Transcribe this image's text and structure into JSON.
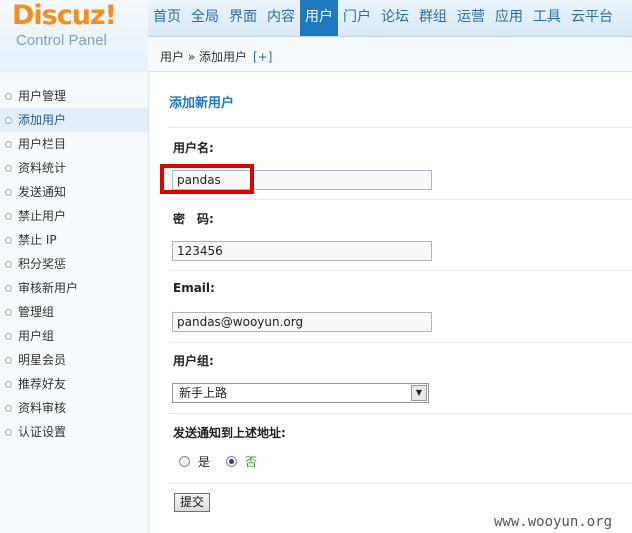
{
  "logo": {
    "main": "Discuz!",
    "sub": "Control Panel"
  },
  "topnav": [
    "首页",
    "全局",
    "界面",
    "内容",
    "用户",
    "门户",
    "论坛",
    "群组",
    "运营",
    "应用",
    "工具",
    "云平台"
  ],
  "breadcrumb": {
    "text": "用户 » 添加用户",
    "plus": "[+]"
  },
  "sidebar": {
    "items": [
      "用户管理",
      "添加用户",
      "用户栏目",
      "资料统计",
      "发送通知",
      "禁止用户",
      "禁止 IP",
      "积分奖惩",
      "审核新用户",
      "管理组",
      "用户组",
      "明星会员",
      "推荐好友",
      "资料审核",
      "认证设置"
    ],
    "active": "添加用户"
  },
  "form": {
    "title": "添加新用户",
    "username_label": "用户名:",
    "username_value": "pandas",
    "password_label": "密　码:",
    "password_value": "123456",
    "email_label": "Email:",
    "email_value": "pandas@wooyun.org",
    "group_label": "用户组:",
    "group_value": "新手上路",
    "notify_label": "发送通知到上述地址:",
    "notify_yes": "是",
    "notify_no": "否",
    "notify_selected": "否",
    "submit_label": "提交"
  },
  "watermark": "www.wooyun.org",
  "colors": {
    "accent": "#1e79bd",
    "logo": "#f78d1e",
    "highlight": "#e10000"
  }
}
